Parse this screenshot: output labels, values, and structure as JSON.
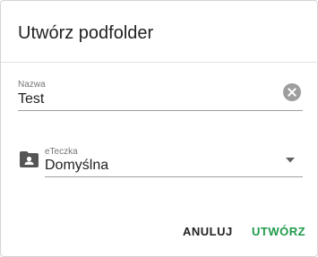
{
  "dialog": {
    "title": "Utwórz podfolder",
    "name_field": {
      "label": "Nazwa",
      "value": "Test",
      "clear_icon": "clear-circle-icon"
    },
    "folder_field": {
      "icon": "folder-account-icon",
      "label": "eTeczka",
      "value": "Domyślna",
      "dropdown_icon": "arrow-drop-down-icon"
    },
    "buttons": {
      "cancel_label": "ANULUJ",
      "create_label": "UTWÓRZ"
    }
  },
  "colors": {
    "accent": "#1e9a49",
    "text": "#212121",
    "label": "#757575",
    "icon": "#9e9e9e"
  }
}
